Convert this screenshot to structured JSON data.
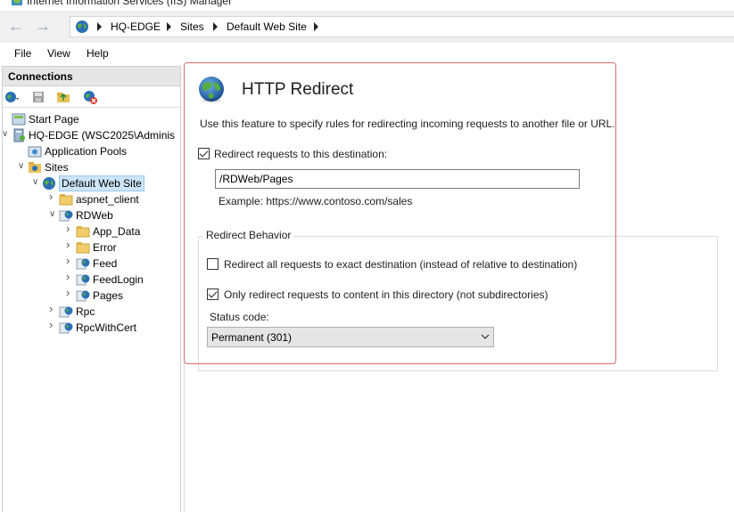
{
  "window": {
    "title": "Internet Information Services (IIS) Manager"
  },
  "address_bar": {
    "back_icon": "back-arrow-icon",
    "forward_icon": "forward-arrow-icon",
    "breadcrumbs": [
      "HQ-EDGE",
      "Sites",
      "Default Web Site"
    ]
  },
  "menu": {
    "items": [
      "File",
      "View",
      "Help"
    ]
  },
  "connections": {
    "header": "Connections",
    "toolbar_icons": [
      "connect-icon",
      "save-icon",
      "up-folder-icon",
      "disconnect-icon"
    ],
    "tree": [
      {
        "label": "Start Page",
        "icon": "start-page-icon",
        "level": 0,
        "twist": ""
      },
      {
        "label": "HQ-EDGE (WSC2025\\Adminis",
        "icon": "server-icon",
        "level": 0,
        "twist": "expanded"
      },
      {
        "label": "Application Pools",
        "icon": "app-pool-icon",
        "level": 1,
        "twist": ""
      },
      {
        "label": "Sites",
        "icon": "sites-folder-icon",
        "level": 1,
        "twist": "expanded"
      },
      {
        "label": "Default Web Site",
        "icon": "globe-icon",
        "level": 2,
        "twist": "expanded",
        "selected": true
      },
      {
        "label": "aspnet_client",
        "icon": "folder-icon",
        "level": 3,
        "twist": "collapsed"
      },
      {
        "label": "RDWeb",
        "icon": "web-app-icon",
        "level": 3,
        "twist": "expanded"
      },
      {
        "label": "App_Data",
        "icon": "folder-icon",
        "level": 4,
        "twist": "collapsed"
      },
      {
        "label": "Error",
        "icon": "folder-icon",
        "level": 4,
        "twist": "collapsed"
      },
      {
        "label": "Feed",
        "icon": "web-app-icon",
        "level": 4,
        "twist": "collapsed"
      },
      {
        "label": "FeedLogin",
        "icon": "web-app-icon",
        "level": 4,
        "twist": "collapsed"
      },
      {
        "label": "Pages",
        "icon": "web-app-icon",
        "level": 4,
        "twist": "collapsed"
      },
      {
        "label": "Rpc",
        "icon": "web-app-icon",
        "level": 3,
        "twist": "collapsed"
      },
      {
        "label": "RpcWithCert",
        "icon": "web-app-icon",
        "level": 3,
        "twist": "collapsed"
      }
    ]
  },
  "feature": {
    "icon": "globe-icon",
    "title": "HTTP Redirect",
    "description": "Use this feature to specify rules for redirecting incoming requests to another file or URL.",
    "redirect_checkbox": {
      "label": "Redirect requests to this destination:",
      "checked": true
    },
    "destination": {
      "value": "/RDWeb/Pages"
    },
    "example": "Example: https://www.contoso.com/sales",
    "behavior": {
      "legend": "Redirect Behavior",
      "exact_destination": {
        "label": "Redirect all requests to exact destination (instead of relative to destination)",
        "checked": false
      },
      "only_this_dir": {
        "label": "Only redirect requests to content in this directory (not subdirectories)",
        "checked": true
      },
      "status_label": "Status code:",
      "status_value": "Permanent (301)"
    }
  },
  "colors": {
    "highlight_border": "#e46a6a",
    "selection_bg": "#cce4f7"
  }
}
